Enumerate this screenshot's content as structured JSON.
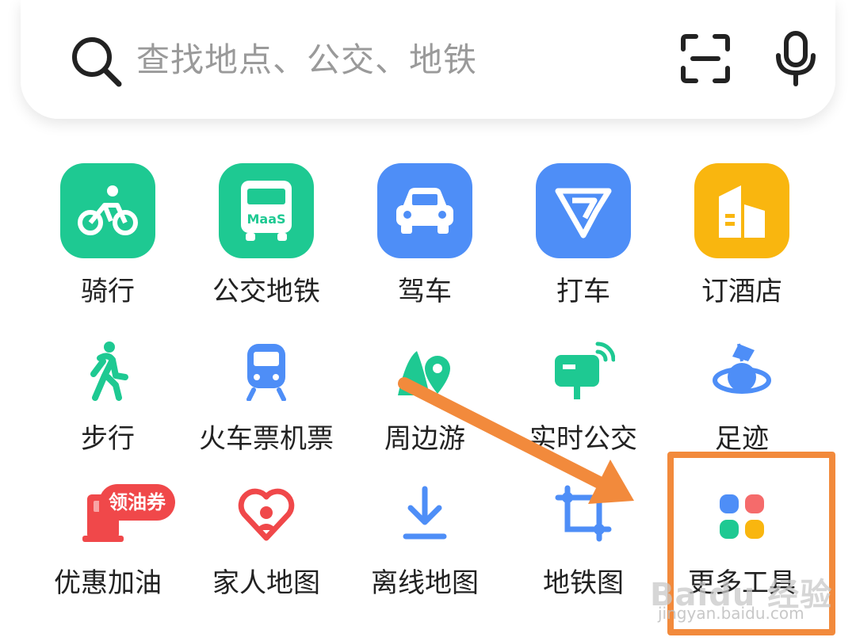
{
  "search": {
    "placeholder": "查找地点、公交、地铁",
    "icons": [
      "search-icon",
      "scan-icon",
      "mic-icon"
    ]
  },
  "row1": [
    {
      "label": "骑行",
      "icon": "bike-icon",
      "color": "#1ec992"
    },
    {
      "label": "公交地铁",
      "icon": "bus-icon",
      "color": "#1ec992",
      "icon_text": "MaaS"
    },
    {
      "label": "驾车",
      "icon": "car-icon",
      "color": "#4e8ef7"
    },
    {
      "label": "打车",
      "icon": "taxi-icon",
      "color": "#4e8ef7"
    },
    {
      "label": "订酒店",
      "icon": "hotel-icon",
      "color": "#f9b60f"
    }
  ],
  "row2": [
    {
      "label": "步行",
      "icon": "walk-icon",
      "color": "#1ec992"
    },
    {
      "label": "火车票机票",
      "icon": "train-icon",
      "color": "#4e8ef7"
    },
    {
      "label": "周边游",
      "icon": "nearby-tour-icon",
      "color": "#1ec992"
    },
    {
      "label": "实时公交",
      "icon": "realtime-bus-icon",
      "color": "#1ec992"
    },
    {
      "label": "足迹",
      "icon": "footprint-icon",
      "color": "#4e8ef7"
    }
  ],
  "row3": [
    {
      "label": "优惠加油",
      "icon": "gas-pump-icon",
      "color": "#f0484a",
      "badge": "领油券"
    },
    {
      "label": "家人地图",
      "icon": "family-map-icon",
      "color": "#f0484a"
    },
    {
      "label": "离线地图",
      "icon": "download-icon",
      "color": "#4e8ef7"
    },
    {
      "label": "地铁图",
      "icon": "subway-map-icon",
      "color": "#4e8ef7"
    },
    {
      "label": "更多工具",
      "icon": "more-tools-icon",
      "color": "#f0484a"
    }
  ],
  "annotation": {
    "arrow_color": "#f28a3c",
    "highlight_color": "#f28a3c"
  },
  "watermark": {
    "brand": "Baidu 经验",
    "url": "jingyan.baidu.com"
  }
}
